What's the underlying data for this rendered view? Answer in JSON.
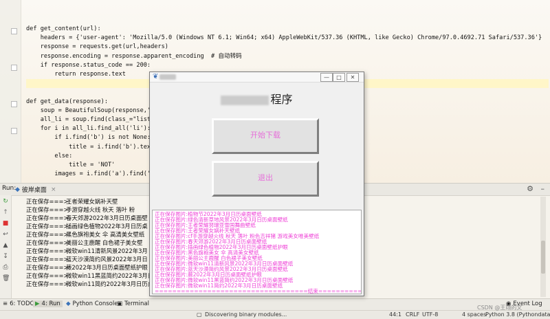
{
  "editor": {
    "lines": [
      {
        "t": "def get_content(url):"
      },
      {
        "t": "    headers = {'user-agent': 'Mozilla/5.0 (Windows NT 6.1; Win64; x64) AppleWebKit/537.36 (KHTML, like Gecko) Chrome/97.0.4692.71 Safari/537.36'}"
      },
      {
        "t": "    response = requests.get(url,headers)"
      },
      {
        "t": "    response.encoding = response.apparent_encoding  # 自动转码"
      },
      {
        "t": "    if response.status_code == 200:"
      },
      {
        "t": "        return response.text"
      },
      {
        "t": ""
      },
      {
        "t": ""
      },
      {
        "t": "def get_data(response):"
      },
      {
        "t": "    soup = BeautifulSoup(response,'lx"
      },
      {
        "t": "    all_li = soup.find(class_=\"list\")"
      },
      {
        "t": "    for i in all_li.find_all('li'):"
      },
      {
        "t": "        if i.find('b') is not None:"
      },
      {
        "t": "            title = i.find('b').text"
      },
      {
        "t": "        else:"
      },
      {
        "t": "            title = 'NOT'"
      },
      {
        "t": "        images = i.find('a').find('im"
      }
    ]
  },
  "run": {
    "label": "Run:",
    "tab_name": "彼岸桌面",
    "console_lines": [
      {
        "pfx": "正在保存===>:",
        "txt": "王者荣耀女娲补天壁"
      },
      {
        "pfx": "正在保存===>:",
        "txt": "手游穿越火线 秋天 落叶 粉"
      },
      {
        "pfx": "正在保存===>:",
        "txt": "春天郊游2022年3月日历桌面壁"
      },
      {
        "pfx": "正在保存===>:",
        "txt": "插画绿色植物2022年3月日历桌"
      },
      {
        "pfx": "正在保存===>:",
        "txt": "黑色旗袍美女 伞 高清美女壁纸"
      },
      {
        "pfx": "正在保存===>:",
        "txt": "美丽公主鹿醒 白色裙子美女壁"
      },
      {
        "pfx": "正在保存===>:",
        "txt": "微软win11清新风景2022年3月"
      },
      {
        "pfx": "正在保存===>:",
        "txt": "蓝天沙漠简约风景2022年3月日"
      },
      {
        "pfx": "正在保存===>:",
        "txt": "蕨2022年3月日历桌面壁纸护眼"
      },
      {
        "pfx": "正在保存===>:",
        "txt": "微软win11黑蓝简约2022年3月日"
      },
      {
        "pfx": "正在保存===>:",
        "txt": "微软win11简约2022年3月日历桌"
      }
    ]
  },
  "tool_tabs": [
    {
      "label": "6: TODO"
    },
    {
      "label": "4: Run"
    },
    {
      "label": "Python Console"
    },
    {
      "label": "Terminal"
    }
  ],
  "event_log": "Event Log",
  "status": {
    "message": "Discovering binary modules...",
    "position": "44:1",
    "line_sep": "CRLF",
    "encoding": "UTF-8",
    "indent": "4 spaces",
    "interpreter": "Python 3.8 (Pythondata)",
    "watermark": "CSDN @王翊的文"
  },
  "app": {
    "heading_suffix": "程序",
    "start_button": "开始下载",
    "exit_button": "退出",
    "min_glyph": "—",
    "max_glyph": "□",
    "close_glyph": "✕",
    "log_lines": [
      "正在保存图片:植物节2022年3月日历桌面壁纸",
      "正在保存图片:绿色清新草地风景2022年3月日历桌面壁纸",
      "正在保存图片:王者荣耀努瑞亚雪国舞曲壁纸",
      "正在保存图片:王者荣耀女娲补天壁纸",
      "正在保存图片:cf手游穿越火线 秋天 落叶 粉色吉祥猪 游戏美女唯美壁纸",
      "正在保存图片:春天郊游2022年3月日历桌面壁纸",
      "正在保存图片:插画绿色植物2022年3月日历桌面壁纸护眼",
      "正在保存图片:黑色旗袍美女 伞 高清美女壁纸",
      "正在保存图片:美丽公主鹿醒 白色裙子美女壁纸",
      "正在保存图片:微软win11清新风景2022年3月日历桌面壁纸",
      "正在保存图片:蓝天沙漠简约风景2022年3月日历桌面壁纸",
      "正在保存图片:蕨2022年3月日历桌面壁纸护眼",
      "正在保存图片:微软win11黑蓝简约2022年3月日历桌面壁纸",
      "正在保存图片:微软win11简约2022年3月日历桌面壁纸",
      "===================================结束==================================="
    ]
  }
}
